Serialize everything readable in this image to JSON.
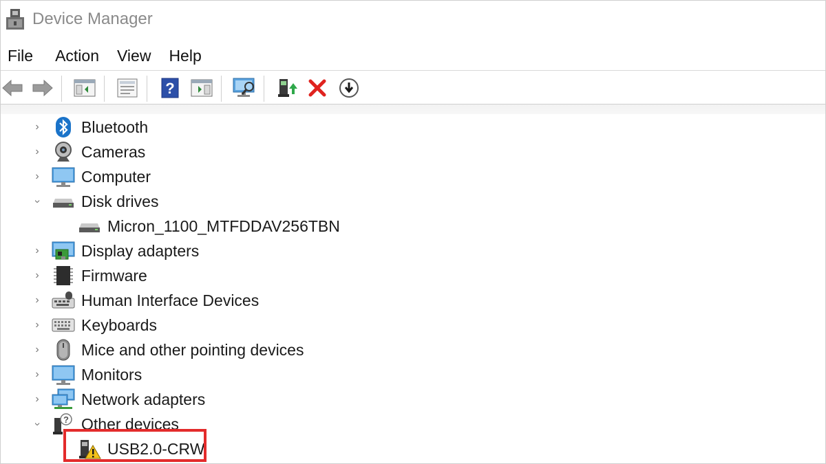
{
  "window": {
    "title": "Device Manager"
  },
  "menu": [
    "File",
    "Action",
    "View",
    "Help"
  ],
  "toolbar": {
    "buttons": [
      {
        "name": "back-icon"
      },
      {
        "name": "forward-icon"
      },
      {
        "name": "show-hide-console-tree-icon"
      },
      {
        "name": "properties-icon"
      },
      {
        "name": "help-icon"
      },
      {
        "name": "run-icon"
      },
      {
        "name": "scan-hardware-icon"
      },
      {
        "name": "update-driver-icon"
      },
      {
        "name": "uninstall-device-icon"
      },
      {
        "name": "disable-device-icon"
      }
    ]
  },
  "tree": [
    {
      "label": "Bluetooth",
      "icon": "bluetooth-icon",
      "expanded": false,
      "level": 0
    },
    {
      "label": "Cameras",
      "icon": "camera-icon",
      "expanded": false,
      "level": 0
    },
    {
      "label": "Computer",
      "icon": "computer-icon",
      "expanded": false,
      "level": 0
    },
    {
      "label": "Disk drives",
      "icon": "disk-drive-icon",
      "expanded": true,
      "level": 0
    },
    {
      "label": "Micron_1100_MTFDDAV256TBN",
      "icon": "disk-drive-icon",
      "level": 1
    },
    {
      "label": "Display adapters",
      "icon": "display-adapter-icon",
      "expanded": false,
      "level": 0
    },
    {
      "label": "Firmware",
      "icon": "firmware-icon",
      "expanded": false,
      "level": 0
    },
    {
      "label": "Human Interface Devices",
      "icon": "hid-icon",
      "expanded": false,
      "level": 0
    },
    {
      "label": "Keyboards",
      "icon": "keyboard-icon",
      "expanded": false,
      "level": 0
    },
    {
      "label": "Mice and other pointing devices",
      "icon": "mouse-icon",
      "expanded": false,
      "level": 0
    },
    {
      "label": "Monitors",
      "icon": "monitor-icon",
      "expanded": false,
      "level": 0
    },
    {
      "label": "Network adapters",
      "icon": "network-adapter-icon",
      "expanded": false,
      "level": 0
    },
    {
      "label": "Other devices",
      "icon": "other-devices-icon",
      "expanded": true,
      "level": 0
    },
    {
      "label": "USB2.0-CRW",
      "icon": "unknown-device-warning-icon",
      "level": 1,
      "highlighted": true
    }
  ],
  "colors": {
    "highlight": "#e32b2b",
    "accent": "#1a73c9"
  }
}
